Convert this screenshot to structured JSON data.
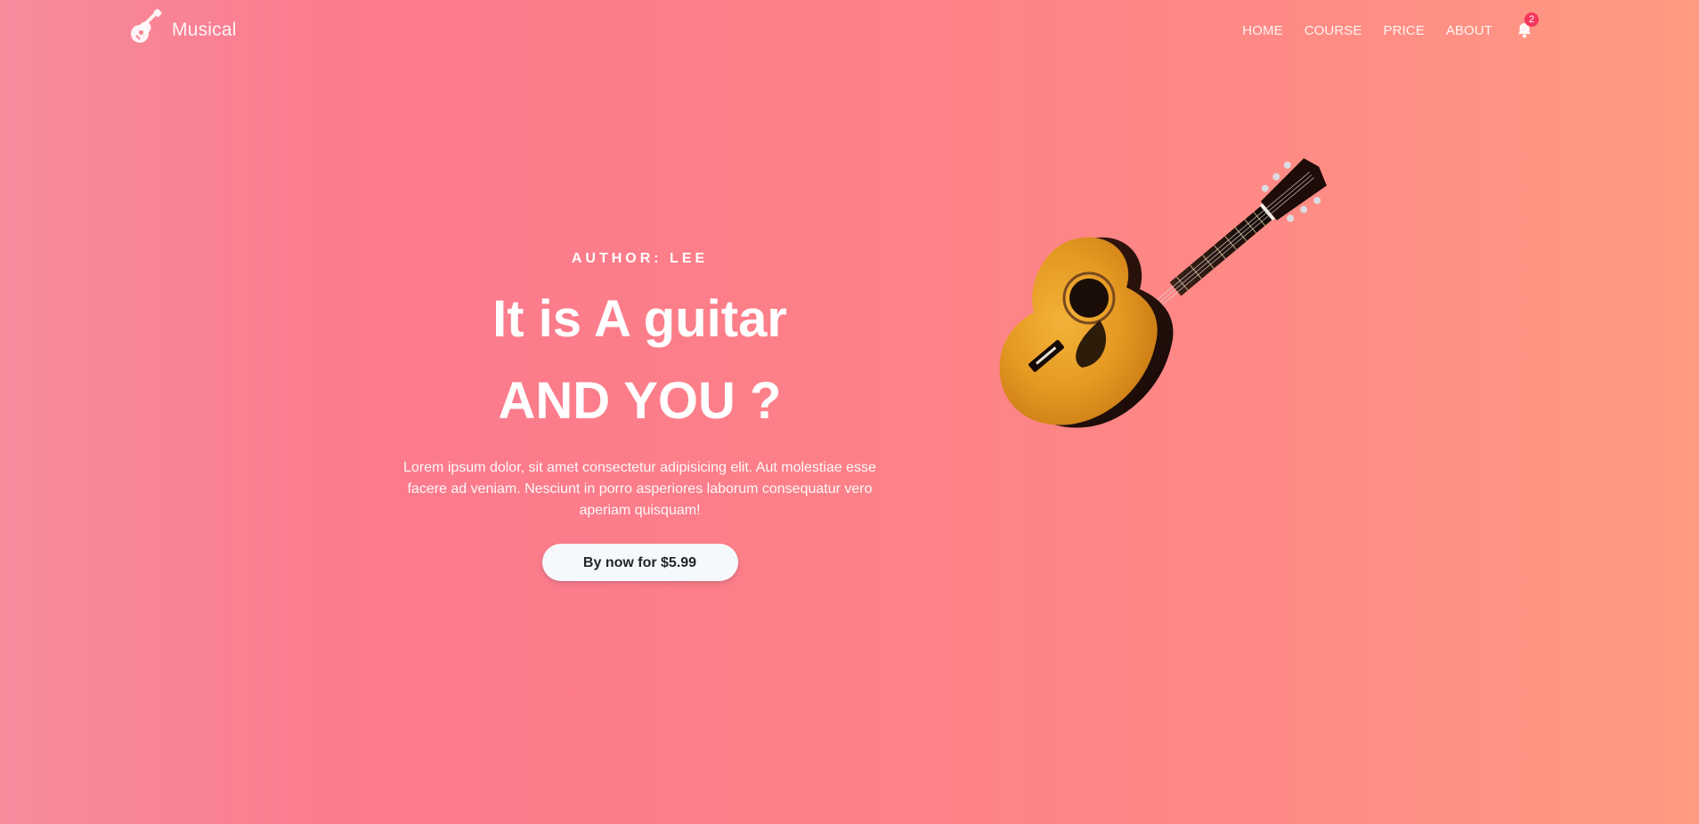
{
  "brand": {
    "name": "Musical",
    "icon": "guitar-icon"
  },
  "nav": {
    "items": [
      {
        "label": "HOME"
      },
      {
        "label": "COURSE"
      },
      {
        "label": "PRICE"
      },
      {
        "label": "ABOUT"
      }
    ],
    "notifications": {
      "icon": "bell-icon",
      "count": "2"
    }
  },
  "hero": {
    "author": "AUTHOR: LEE",
    "title_line1": "It is A guitar",
    "title_line2": "AND YOU ?",
    "description": "Lorem ipsum dolor, sit amet consectetur adipisicing elit. Aut molestiae esse facere ad veniam. Nesciunt in porro asperiores laborum consequatur vero aperiam quisquam!",
    "button_label": "By now for $5.99"
  },
  "colors": {
    "badge": "#f5365c",
    "button_bg": "#f6f9fc",
    "gradient_left": "#f78b9c",
    "gradient_right": "#ff9a82"
  }
}
